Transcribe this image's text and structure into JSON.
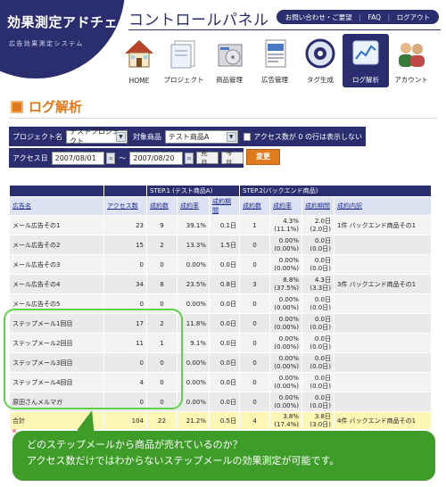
{
  "brand": {
    "title": "効果測定アドチェック",
    "subtitle": "広告効果測定システム",
    "navy": "#2a2e6e"
  },
  "header": {
    "app_title": "コントロールパネル",
    "links": [
      "お問い合わせ・ご要望",
      "FAQ",
      "ログアウト"
    ]
  },
  "nav": {
    "items": [
      {
        "label": "HOME",
        "icon": "house-icon"
      },
      {
        "label": "プロジェクト",
        "icon": "folder-icon"
      },
      {
        "label": "商品管理",
        "icon": "product-box-icon"
      },
      {
        "label": "広告管理",
        "icon": "document-icon"
      },
      {
        "label": "タグ生成",
        "icon": "tag-gear-icon"
      },
      {
        "label": "ログ解析",
        "icon": "line-graph-icon",
        "active": true
      },
      {
        "label": "アカウント",
        "icon": "users-icon"
      }
    ]
  },
  "page": {
    "title": "ログ解析",
    "accent": "#e07a1c"
  },
  "filters": {
    "project_label": "プロジェクト名",
    "project_value": "テストプロジェクト",
    "product_label": "対象商品",
    "product_value": "テスト商品A",
    "hide_zero_label": "アクセス数が 0 の行は表示しない",
    "date_label": "アクセス日",
    "date_from": "2007/08/01",
    "date_sep": "～",
    "date_to": "2007/08/20",
    "prev_month": "先月",
    "this_month": "今月",
    "change_button": "変更"
  },
  "table": {
    "group_headers": [
      "STEP.1 (テスト商品A)",
      "STEP.2(バックエンド商品)"
    ],
    "columns": [
      "広告名",
      "アクセス数",
      "成約数",
      "成約率",
      "成約期間",
      "成約数",
      "成約率",
      "成約期間",
      "成約内訳"
    ],
    "rows": [
      {
        "name": "メール広告その1",
        "access": "23",
        "s1_count": "9",
        "s1_rate": "39.1%",
        "s1_period": "0.1日",
        "s2_count": "1",
        "s2_rate_a": "4.3%",
        "s2_rate_b": "(11.1%)",
        "s2_period_a": "2.0日",
        "s2_period_b": "(2.0日)",
        "breakdown": "1件 バックエンド商品その1"
      },
      {
        "name": "メール広告その2",
        "access": "15",
        "s1_count": "2",
        "s1_rate": "13.3%",
        "s1_period": "1.5日",
        "s2_count": "0",
        "s2_rate_a": "0.00%",
        "s2_rate_b": "(0.00%)",
        "s2_period_a": "0.0日",
        "s2_period_b": "(0.0日)",
        "breakdown": ""
      },
      {
        "name": "メール広告その3",
        "access": "0",
        "s1_count": "0",
        "s1_rate": "0.00%",
        "s1_period": "0.0日",
        "s2_count": "0",
        "s2_rate_a": "0.00%",
        "s2_rate_b": "(0.00%)",
        "s2_period_a": "0.0日",
        "s2_period_b": "(0.0日)",
        "breakdown": ""
      },
      {
        "name": "メール広告その4",
        "access": "34",
        "s1_count": "8",
        "s1_rate": "23.5%",
        "s1_period": "0.8日",
        "s2_count": "3",
        "s2_rate_a": "8.8%",
        "s2_rate_b": "(37.5%)",
        "s2_period_a": "4.3日",
        "s2_period_b": "(3.3日)",
        "breakdown": "3件 バックエンド商品その1"
      },
      {
        "name": "メール広告その5",
        "access": "0",
        "s1_count": "0",
        "s1_rate": "0.00%",
        "s1_period": "0.0日",
        "s2_count": "0",
        "s2_rate_a": "0.00%",
        "s2_rate_b": "(0.00%)",
        "s2_period_a": "0.0日",
        "s2_period_b": "(0.0日)",
        "breakdown": ""
      },
      {
        "name": "ステップメール1回目",
        "access": "17",
        "s1_count": "2",
        "s1_rate": "11.8%",
        "s1_period": "0.0日",
        "s2_count": "0",
        "s2_rate_a": "0.00%",
        "s2_rate_b": "(0.00%)",
        "s2_period_a": "0.0日",
        "s2_period_b": "(0.0日)",
        "breakdown": ""
      },
      {
        "name": "ステップメール2回目",
        "access": "11",
        "s1_count": "1",
        "s1_rate": "9.1%",
        "s1_period": "0.0日",
        "s2_count": "0",
        "s2_rate_a": "0.00%",
        "s2_rate_b": "(0.00%)",
        "s2_period_a": "0.0日",
        "s2_period_b": "(0.0日)",
        "breakdown": ""
      },
      {
        "name": "ステップメール3回目",
        "access": "0",
        "s1_count": "0",
        "s1_rate": "0.00%",
        "s1_period": "0.0日",
        "s2_count": "0",
        "s2_rate_a": "0.00%",
        "s2_rate_b": "(0.00%)",
        "s2_period_a": "0.0日",
        "s2_period_b": "(0.0日)",
        "breakdown": ""
      },
      {
        "name": "ステップメール4回目",
        "access": "4",
        "s1_count": "0",
        "s1_rate": "0.00%",
        "s1_period": "0.0日",
        "s2_count": "0",
        "s2_rate_a": "0.00%",
        "s2_rate_b": "(0.00%)",
        "s2_period_a": "0.0日",
        "s2_period_b": "(0.0日)",
        "breakdown": ""
      },
      {
        "name": "原田さんメルマガ",
        "access": "0",
        "s1_count": "0",
        "s1_rate": "0.00%",
        "s1_period": "0.0日",
        "s2_count": "0",
        "s2_rate_a": "0.00%",
        "s2_rate_b": "(0.00%)",
        "s2_period_a": "0.0日",
        "s2_period_b": "(0.0日)",
        "breakdown": ""
      }
    ],
    "total": {
      "name": "合計",
      "access": "104",
      "s1_count": "22",
      "s1_rate": "21.2%",
      "s1_period": "0.5日",
      "s2_count": "4",
      "s2_rate_a": "3.8%",
      "s2_rate_b": "(17.4%)",
      "s2_period_a": "3.8日",
      "s2_period_b": "(3.0日)",
      "breakdown": "4件 バックエンド商品その1"
    }
  },
  "callout": {
    "line1": "どのステップメールから商品が売れているのか？",
    "line2": "アクセス数だけではわからないステップメールの効果測定が可能です。",
    "color": "#3e9c28"
  },
  "footnote": "＊"
}
